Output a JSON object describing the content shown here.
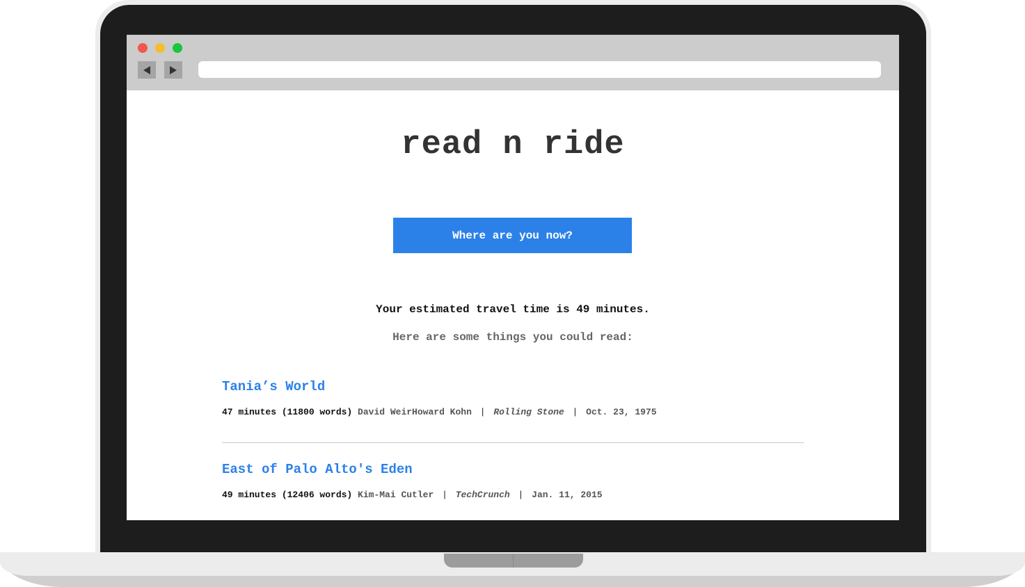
{
  "site": {
    "title": "read n ride"
  },
  "locate_button": {
    "label": "Where are you now?"
  },
  "travel": {
    "message": "Your estimated travel time is 49 minutes."
  },
  "suggestions": {
    "heading": "Here are some things you could read:"
  },
  "articles": [
    {
      "title": "Tania’s World",
      "time": "47 minutes (11800 words)",
      "author": "David WeirHoward Kohn",
      "source": "Rolling Stone",
      "date": "Oct. 23, 1975"
    },
    {
      "title": "East of Palo Alto's Eden",
      "time": "49 minutes (12406 words)",
      "author": "Kim-Mai Cutler",
      "source": "TechCrunch",
      "date": "Jan. 11, 2015"
    }
  ],
  "separator": "|",
  "icons": {
    "back": "triangle-left-icon",
    "forward": "triangle-right-icon"
  },
  "colors": {
    "accent": "#2b81e8",
    "close": "#f25650",
    "minimize": "#f6bd2f",
    "maximize": "#18c63d"
  }
}
